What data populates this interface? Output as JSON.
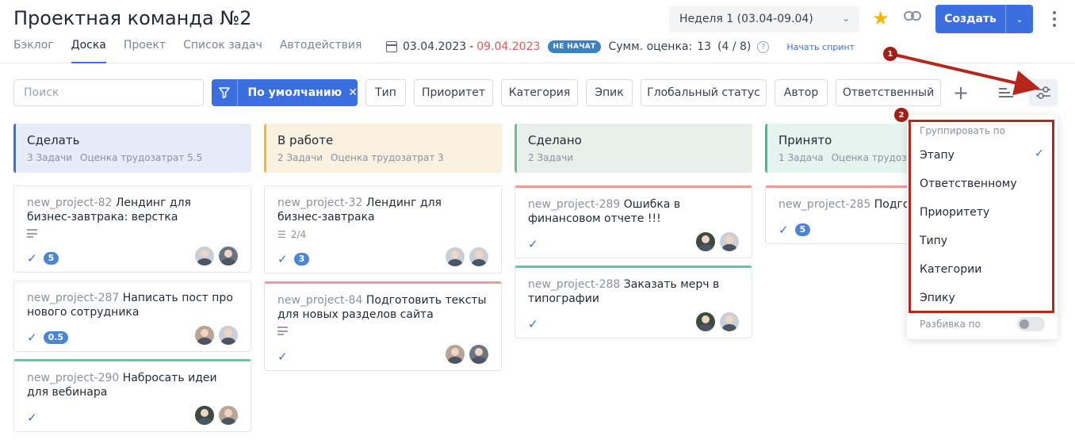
{
  "header": {
    "title": "Проектная команда №2",
    "tabs": [
      {
        "label": "Бэклог",
        "active": false
      },
      {
        "label": "Доска",
        "active": true
      },
      {
        "label": "Проект",
        "active": false
      },
      {
        "label": "Список задач",
        "active": false
      },
      {
        "label": "Автодействия",
        "active": false
      }
    ],
    "sprint": {
      "date_start": "03.04.2023",
      "date_sep": "-",
      "date_end": "09.04.2023",
      "status": "НЕ НАЧАТ",
      "sum_label": "Сумм. оценка:",
      "sum_value": "13",
      "sum_breakdown": "(4 / 8)",
      "help_glyph": "?",
      "start_link": "Начать спринт"
    },
    "week_select": {
      "value": "Неделя 1 (03.04-09.04)"
    },
    "create_label": "Создать",
    "star_icon": "star-icon",
    "link_icon": "link-icon"
  },
  "filters": {
    "search_placeholder": "Поиск",
    "preset_label": "По умолчанию",
    "buttons": [
      "Тип",
      "Приоритет",
      "Категория",
      "Эпик",
      "Глобальный статус",
      "Автор",
      "Ответственный"
    ]
  },
  "columns": [
    {
      "title": "Сделать",
      "count": "3 Задачи",
      "estimate": "Оценка трудозатрат 5.5",
      "color": "#e8ecf8",
      "accent": "#3b6fe0"
    },
    {
      "title": "В работе",
      "count": "2 Задачи",
      "estimate": "Оценка трудозатрат 3",
      "color": "#faf1e1",
      "accent": "#f2b63c"
    },
    {
      "title": "Сделано",
      "count": "2 Задачи",
      "estimate": "",
      "color": "#e9f0ec",
      "accent": "#6cc38a"
    },
    {
      "title": "Принято",
      "count": "1 Задача",
      "estimate": "Оценка трудозатрат",
      "color": "#e6f4ef",
      "accent": "#3fbf8e"
    }
  ],
  "cards": {
    "c82": {
      "key": "new_project-82",
      "title": "Лендинг для бизнес-завтрака: верстка",
      "estimate": "5"
    },
    "c287": {
      "key": "new_project-287",
      "title": "Написать пост про нового сотрудника",
      "estimate": "0.5"
    },
    "c290": {
      "key": "new_project-290",
      "title": "Набросать идеи для вебинара"
    },
    "c32": {
      "key": "new_project-32",
      "title": "Лендинг для бизнес-завтрака",
      "subtasks": "2/4",
      "estimate": "3"
    },
    "c84": {
      "key": "new_project-84",
      "title": "Подготовить тексты для новых разделов сайта"
    },
    "c289": {
      "key": "new_project-289",
      "title": "Ошибка в финансовом отчете !!!"
    },
    "c288": {
      "key": "new_project-288",
      "title": "Заказать мерч в типографии"
    },
    "c285": {
      "key": "new_project-285",
      "title": "Подгото",
      "estimate": "5"
    }
  },
  "group_menu": {
    "header": "Группировать по",
    "items": [
      "Этапу",
      "Ответственному",
      "Приоритету",
      "Типу",
      "Категории",
      "Эпику"
    ],
    "selected": "Этапу",
    "split_label": "Разбивка по",
    "split_enabled": false
  },
  "annotations": {
    "a1": "1",
    "a2": "2",
    "arrow_color": "#b5261b"
  }
}
